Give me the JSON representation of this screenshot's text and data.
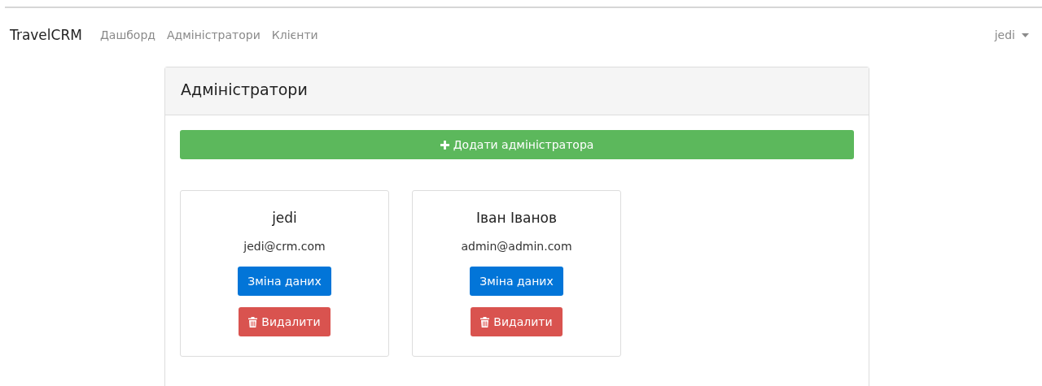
{
  "navbar": {
    "brand": "TravelCRM",
    "links": [
      "Дашборд",
      "Адміністратори",
      "Клієнти"
    ],
    "user_menu": "jedi"
  },
  "panel": {
    "title": "Адміністратори",
    "add_button": "Додати адміністратора",
    "admins": [
      {
        "name": "jedi",
        "email": "jedi@crm.com",
        "edit_button": "Зміна даних",
        "delete_button": "Видалити"
      },
      {
        "name": "Іван Іванов",
        "email": "admin@admin.com",
        "edit_button": "Зміна даних",
        "delete_button": "Видалити"
      }
    ]
  }
}
